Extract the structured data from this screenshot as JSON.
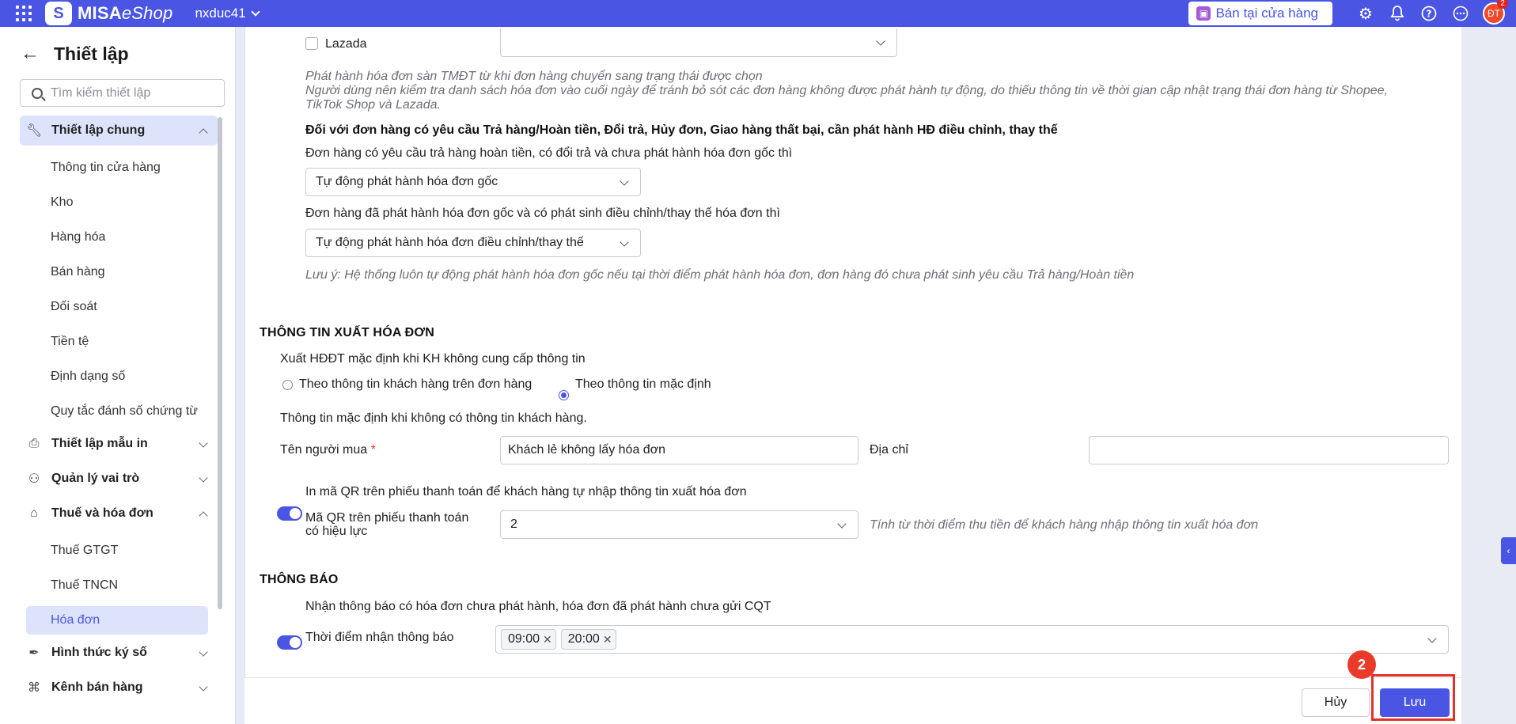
{
  "topbar": {
    "logo_badge": "S",
    "logo_bold": "MISA",
    "logo_rest": "eShop",
    "shop_name": "nxduc41",
    "sell_button": "Bán tại cửa hàng",
    "avatar_initials": "ĐT",
    "notification_count": "2"
  },
  "sidebar": {
    "title": "Thiết lập",
    "search_placeholder": "Tìm kiếm thiết lập",
    "groups": [
      {
        "label": "Thiết lập chung",
        "expanded": true,
        "items": [
          "Thông tin cửa hàng",
          "Kho",
          "Hàng hóa",
          "Bán hàng",
          "Đối soát",
          "Tiền tệ",
          "Định dạng số",
          "Quy tắc đánh số chứng từ"
        ]
      },
      {
        "label": "Thiết lập mẫu in",
        "expanded": false,
        "items": []
      },
      {
        "label": "Quản lý vai trò",
        "expanded": false,
        "items": []
      },
      {
        "label": "Thuế và hóa đơn",
        "expanded": true,
        "items": [
          "Thuế GTGT",
          "Thuế TNCN",
          "Hóa đơn"
        ],
        "active_item": "Hóa đơn"
      },
      {
        "label": "Hình thức ký số",
        "expanded": false,
        "items": []
      },
      {
        "label": "Kênh bán hàng",
        "expanded": false,
        "items": []
      }
    ]
  },
  "ecommerce": {
    "lazada_label": "Lazada",
    "lazada_select": "",
    "note_line1": "Phát hành hóa đơn sàn TMĐT từ khi đơn hàng chuyển sang trạng thái được chọn",
    "note_line2": "Người dùng nên kiểm tra danh sách hóa đơn vào cuối ngày để tránh bỏ sót các đơn hàng không được phát hành tự động, do thiếu thông tin về thời gian cập nhật trạng thái đơn hàng từ Shopee,",
    "note_line3": "TikTok Shop và Lazada.",
    "returns_heading": "Đối với đơn hàng có yêu cầu Trả hàng/Hoàn tiền, Đổi trả, Hủy đơn, Giao hàng thất bại, cần phát hành HĐ điều chỉnh, thay thế",
    "q1_label": "Đơn hàng có yêu cầu trả hàng hoàn tiền, có đổi trả và chưa phát hành hóa đơn gốc thì",
    "q1_value": "Tự động phát hành hóa đơn gốc",
    "q2_label": "Đơn hàng đã phát hành hóa đơn gốc và có phát sinh điều chỉnh/thay thế hóa đơn thì",
    "q2_value": "Tự động phát hành hóa đơn điều chỉnh/thay thế",
    "warning_note": "Lưu ý: Hệ thống luôn tự động phát hành hóa đơn gốc nếu tại thời điểm phát hành hóa đơn, đơn hàng đó chưa phát sinh yêu cầu Trả hàng/Hoàn tiền"
  },
  "invoice_info": {
    "title": "THÔNG TIN XUẤT HÓA ĐƠN",
    "default_export_label": "Xuất HĐĐT mặc định khi KH không cung cấp thông tin",
    "radio_customer": "Theo thông tin khách hàng trên đơn hàng",
    "radio_default": "Theo thông tin mặc định",
    "selected_radio": "default",
    "default_info_label": "Thông tin mặc định khi không có thông tin khách hàng.",
    "buyer_name_label": "Tên người mua",
    "required_mark": "*",
    "buyer_name_value": "Khách lẻ không lấy hóa đơn",
    "address_label": "Địa chỉ",
    "address_value": "",
    "qr_toggle_label": "In mã QR trên phiếu thanh toán để khách hàng tự nhập thông tin xuất hóa đơn",
    "qr_toggle_on": true,
    "qr_valid_label_1": "Mã QR trên phiếu thanh toán",
    "qr_valid_label_2": "có hiệu lực",
    "qr_valid_value": "2",
    "qr_valid_note": "Tính từ thời điểm thu tiền để khách hàng nhập thông tin xuất hóa đơn"
  },
  "notifications": {
    "title": "THÔNG BÁO",
    "toggle_label": "Nhận thông báo có hóa đơn chưa phát hành, hóa đơn đã phát hành chưa gửi CQT",
    "toggle_on": true,
    "time_label": "Thời điểm nhận thông báo",
    "times": [
      "09:00",
      "20:00"
    ]
  },
  "footer": {
    "cancel": "Hủy",
    "save": "Lưu",
    "step_number": "2"
  },
  "colors": {
    "primary": "#4a55e3",
    "highlight": "#e0322b"
  }
}
